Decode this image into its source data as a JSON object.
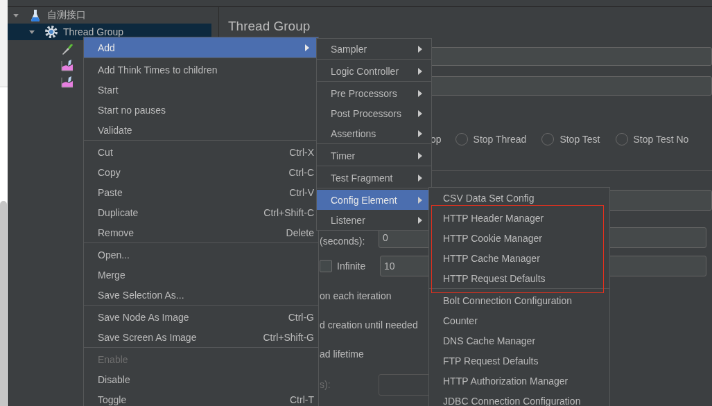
{
  "tree": [
    {
      "label": "自测接口",
      "kind": "test-plan",
      "expanded": true,
      "selected": false,
      "children": [
        {
          "label": "Thread Group",
          "kind": "thread-group",
          "expanded": true,
          "selected": true,
          "children": [
            {
              "kind": "sampler"
            },
            {
              "kind": "listener"
            },
            {
              "kind": "listener"
            }
          ]
        }
      ]
    }
  ],
  "panel": {
    "title": "Thread Group",
    "error_action": {
      "label_fragment": "op",
      "options": [
        {
          "label": "Stop Thread",
          "selected": false
        },
        {
          "label": "Stop Test",
          "selected": false
        },
        {
          "label": "Stop Test No",
          "selected": false
        }
      ]
    },
    "ramp_up": {
      "label": "(seconds):",
      "value": "0"
    },
    "loop_count": {
      "infinite_label": "Infinite",
      "infinite_checked": false,
      "value": "10"
    },
    "lines": [
      "on each iteration",
      "d creation until needed",
      "ad lifetime"
    ],
    "duration": {
      "label": "s):",
      "disabled": true
    }
  },
  "context_menu": {
    "groups": [
      [
        {
          "label": "Add",
          "submenu": true,
          "selected": true,
          "disabled": false
        }
      ],
      [
        {
          "label": "Add Think Times to children",
          "selected": false,
          "disabled": false
        },
        {
          "label": "Start",
          "selected": false,
          "disabled": false
        },
        {
          "label": "Start no pauses",
          "selected": false,
          "disabled": false
        },
        {
          "label": "Validate",
          "selected": false,
          "disabled": false
        }
      ],
      [
        {
          "label": "Cut",
          "shortcut": "Ctrl-X",
          "selected": false,
          "disabled": false
        },
        {
          "label": "Copy",
          "shortcut": "Ctrl-C",
          "selected": false,
          "disabled": false
        },
        {
          "label": "Paste",
          "shortcut": "Ctrl-V",
          "selected": false,
          "disabled": false
        },
        {
          "label": "Duplicate",
          "shortcut": "Ctrl+Shift-C",
          "selected": false,
          "disabled": false
        },
        {
          "label": "Remove",
          "shortcut": "Delete",
          "selected": false,
          "disabled": false
        }
      ],
      [
        {
          "label": "Open...",
          "selected": false,
          "disabled": false
        },
        {
          "label": "Merge",
          "selected": false,
          "disabled": false
        },
        {
          "label": "Save Selection As...",
          "selected": false,
          "disabled": false
        }
      ],
      [
        {
          "label": "Save Node As Image",
          "shortcut": "Ctrl-G",
          "selected": false,
          "disabled": false
        },
        {
          "label": "Save Screen As Image",
          "shortcut": "Ctrl+Shift-G",
          "selected": false,
          "disabled": false
        }
      ],
      [
        {
          "label": "Enable",
          "selected": false,
          "disabled": true
        },
        {
          "label": "Disable",
          "selected": false,
          "disabled": false
        },
        {
          "label": "Toggle",
          "shortcut": "Ctrl-T",
          "selected": false,
          "disabled": false
        }
      ]
    ]
  },
  "add_menu": {
    "groups": [
      [
        {
          "label": "Sampler",
          "submenu": true,
          "selected": false
        }
      ],
      [
        {
          "label": "Logic Controller",
          "submenu": true,
          "selected": false
        }
      ],
      [
        {
          "label": "Pre Processors",
          "submenu": true,
          "selected": false
        },
        {
          "label": "Post Processors",
          "submenu": true,
          "selected": false
        },
        {
          "label": "Assertions",
          "submenu": true,
          "selected": false
        }
      ],
      [
        {
          "label": "Timer",
          "submenu": true,
          "selected": false
        }
      ],
      [
        {
          "label": "Test Fragment",
          "submenu": true,
          "selected": false
        }
      ],
      [
        {
          "label": "Config Element",
          "submenu": true,
          "selected": true
        },
        {
          "label": "Listener",
          "submenu": true,
          "selected": false
        }
      ]
    ]
  },
  "config_menu": {
    "groups": [
      {
        "highlighted": false,
        "items": [
          {
            "label": "CSV Data Set Config",
            "selected": false
          }
        ]
      },
      {
        "highlighted": true,
        "items": [
          {
            "label": "HTTP Header Manager",
            "selected": false
          },
          {
            "label": "HTTP Cookie Manager",
            "selected": false
          },
          {
            "label": "HTTP Cache Manager",
            "selected": false
          },
          {
            "label": "HTTP Request Defaults",
            "selected": false
          }
        ]
      },
      {
        "highlighted": false,
        "items": [
          {
            "label": "Bolt Connection Configuration",
            "selected": false
          },
          {
            "label": "Counter",
            "selected": false
          },
          {
            "label": "DNS Cache Manager",
            "selected": false
          },
          {
            "label": "FTP Request Defaults",
            "selected": false
          },
          {
            "label": "HTTP Authorization Manager",
            "selected": false
          },
          {
            "label": "JDBC Connection Configuration",
            "selected": false
          }
        ]
      }
    ]
  }
}
